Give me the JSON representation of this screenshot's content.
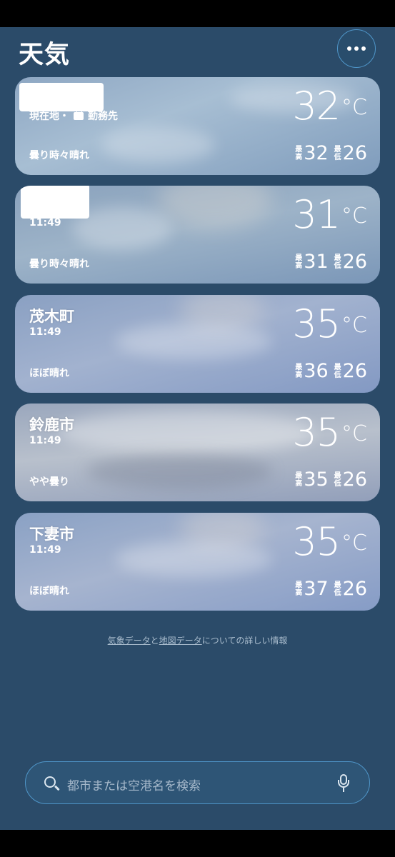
{
  "header": {
    "title": "天気",
    "more_label": "•••"
  },
  "cards": [
    {
      "name": "",
      "sub": "現在地・",
      "sub_extra": "勤務先",
      "condition": "曇り時々晴れ",
      "temp": "32",
      "unit": "°C",
      "high_label": [
        "最",
        "高"
      ],
      "high": "32",
      "low_label": [
        "最",
        "低"
      ],
      "low": "26"
    },
    {
      "name": "",
      "sub": "11:49",
      "condition": "曇り時々晴れ",
      "temp": "31",
      "unit": "°C",
      "high_label": [
        "最",
        "高"
      ],
      "high": "31",
      "low_label": [
        "最",
        "低"
      ],
      "low": "26"
    },
    {
      "name": "茂木町",
      "sub": "11:49",
      "condition": "ほぼ晴れ",
      "temp": "35",
      "unit": "°C",
      "high_label": [
        "最",
        "高"
      ],
      "high": "36",
      "low_label": [
        "最",
        "低"
      ],
      "low": "26"
    },
    {
      "name": "鈴鹿市",
      "sub": "11:49",
      "condition": "やや曇り",
      "temp": "35",
      "unit": "°C",
      "high_label": [
        "最",
        "高"
      ],
      "high": "35",
      "low_label": [
        "最",
        "低"
      ],
      "low": "26"
    },
    {
      "name": "下妻市",
      "sub": "11:49",
      "condition": "ほぼ晴れ",
      "temp": "35",
      "unit": "°C",
      "high_label": [
        "最",
        "高"
      ],
      "high": "37",
      "low_label": [
        "最",
        "低"
      ],
      "low": "26"
    }
  ],
  "footer": {
    "link1": "気象データ",
    "mid": "と",
    "link2": "地図データ",
    "tail": "についての詳しい情報"
  },
  "search": {
    "placeholder": "都市または空港名を検索"
  }
}
